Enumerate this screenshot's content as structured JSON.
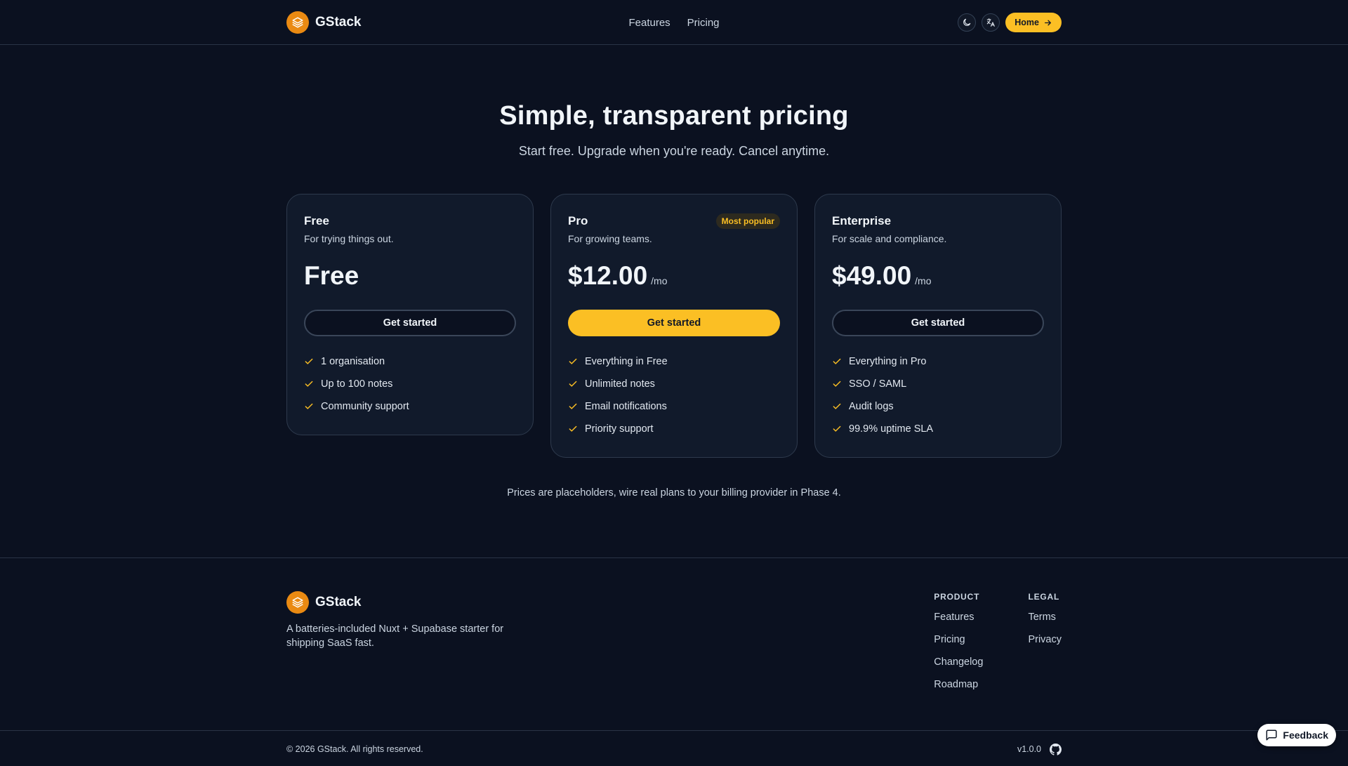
{
  "header": {
    "brand": "GStack",
    "nav": [
      "Features",
      "Pricing"
    ],
    "home_label": "Home",
    "theme_icon": "moon-icon",
    "language_icon": "translate-icon"
  },
  "hero": {
    "title": "Simple, transparent pricing",
    "subtitle": "Start free. Upgrade when you're ready. Cancel anytime."
  },
  "plans": [
    {
      "name": "Free",
      "description": "For trying things out.",
      "price": "Free",
      "period": "",
      "cta": "Get started",
      "features": [
        "1 organisation",
        "Up to 100 notes",
        "Community support"
      ]
    },
    {
      "name": "Pro",
      "badge": "Most popular",
      "description": "For growing teams.",
      "price": "$12.00",
      "period": "/mo",
      "cta": "Get started",
      "features": [
        "Everything in Free",
        "Unlimited notes",
        "Email notifications",
        "Priority support"
      ]
    },
    {
      "name": "Enterprise",
      "description": "For scale and compliance.",
      "price": "$49.00",
      "period": "/mo",
      "cta": "Get started",
      "features": [
        "Everything in Pro",
        "SSO / SAML",
        "Audit logs",
        "99.9% uptime SLA"
      ]
    }
  ],
  "note": "Prices are placeholders, wire real plans to your billing provider in Phase 4.",
  "footer": {
    "brand": "GStack",
    "tagline": "A batteries-included Nuxt + Supabase starter for shipping SaaS fast.",
    "columns": [
      {
        "title": "PRODUCT",
        "links": [
          "Features",
          "Pricing",
          "Changelog",
          "Roadmap"
        ]
      },
      {
        "title": "LEGAL",
        "links": [
          "Terms",
          "Privacy"
        ]
      }
    ],
    "copyright": "© 2026 GStack. All rights reserved.",
    "version": "v1.0.0"
  },
  "feedback_label": "Feedback",
  "colors": {
    "background": "#0b1120",
    "accent": "#fbbf24",
    "logo": "#ea8a12",
    "card": "#111a2b"
  }
}
